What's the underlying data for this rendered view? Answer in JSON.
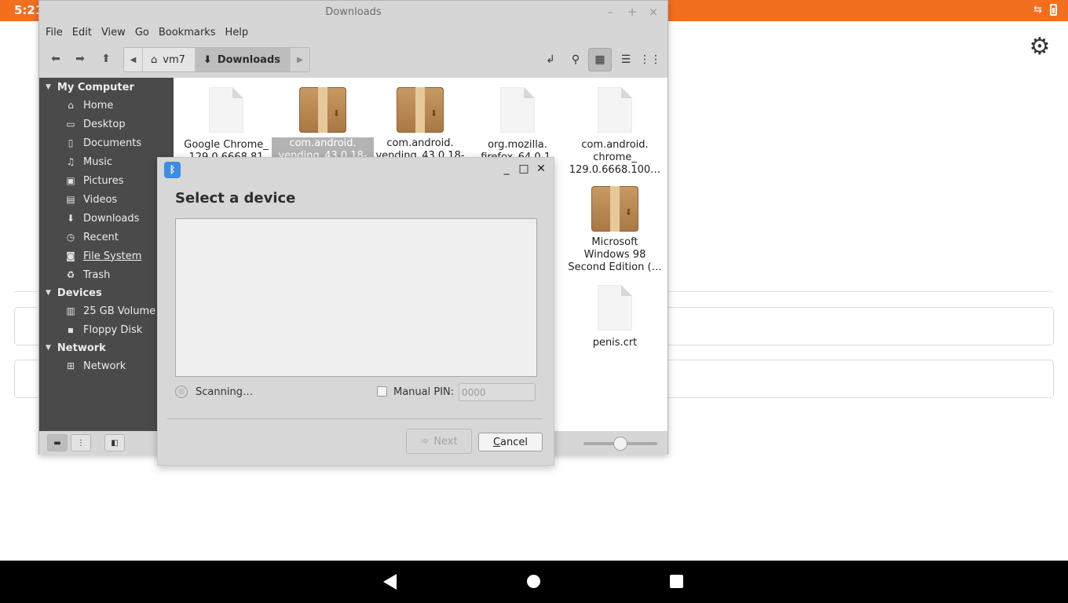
{
  "status_bar": {
    "time": "5:21",
    "bg_color": "#f26f1f"
  },
  "app": {
    "settings_icon": "gear-icon"
  },
  "file_manager": {
    "title": "Downloads",
    "window_buttons": {
      "minimize": "–",
      "maximize": "+",
      "close": "×"
    },
    "menu": [
      "File",
      "Edit",
      "View",
      "Go",
      "Bookmarks",
      "Help"
    ],
    "toolbar_icons": [
      "back-arrow-icon",
      "forward-arrow-icon",
      "up-arrow-icon"
    ],
    "pathbar": {
      "home": "vm7",
      "current": "Downloads"
    },
    "sidebar": {
      "sections": [
        {
          "label": "My Computer",
          "items": [
            {
              "label": "Home",
              "icon": "home-icon"
            },
            {
              "label": "Desktop",
              "icon": "desktop-icon"
            },
            {
              "label": "Documents",
              "icon": "documents-icon"
            },
            {
              "label": "Music",
              "icon": "music-icon"
            },
            {
              "label": "Pictures",
              "icon": "pictures-icon"
            },
            {
              "label": "Videos",
              "icon": "videos-icon"
            },
            {
              "label": "Downloads",
              "icon": "downloads-icon"
            },
            {
              "label": "Recent",
              "icon": "recent-icon"
            },
            {
              "label": "File System",
              "icon": "drive-icon"
            },
            {
              "label": "Trash",
              "icon": "trash-icon"
            }
          ]
        },
        {
          "label": "Devices",
          "items": [
            {
              "label": "25 GB Volume",
              "icon": "volume-icon"
            },
            {
              "label": "Floppy Disk",
              "icon": "floppy-icon"
            }
          ]
        },
        {
          "label": "Network",
          "items": [
            {
              "label": "Network",
              "icon": "network-icon"
            }
          ]
        }
      ]
    },
    "files": [
      {
        "line1": "Google Chrome_",
        "line2": "129.0.6668.81",
        "line3": "",
        "type": "document"
      },
      {
        "line1": "com.android.",
        "line2": "vending_43.0.18-",
        "line3": "",
        "type": "package",
        "selected": true
      },
      {
        "line1": "com.android.",
        "line2": "vending_43.0.18-",
        "line3": "",
        "type": "package"
      },
      {
        "line1": "org.mozilla.",
        "line2": "firefox_64.0.1-",
        "line3": "",
        "type": "document"
      },
      {
        "line1": "com.android.",
        "line2": "chrome_",
        "line3": "129.0.6668.100…",
        "type": "document"
      },
      {
        "line1": "Microsoft",
        "line2": "Windows 98",
        "line3": "Second Edition (…",
        "type": "package"
      },
      {
        "line1": "penis.crt",
        "line2": "",
        "line3": "",
        "type": "document"
      }
    ]
  },
  "bluetooth_dialog": {
    "icon": "bluetooth-icon",
    "heading": "Select a device",
    "scanning_text": "Scanning…",
    "manual_pin_label": "Manual PIN:",
    "manual_pin_checked": false,
    "pin_value": "0000",
    "next_label": "Next",
    "cancel_label": "Cancel"
  }
}
